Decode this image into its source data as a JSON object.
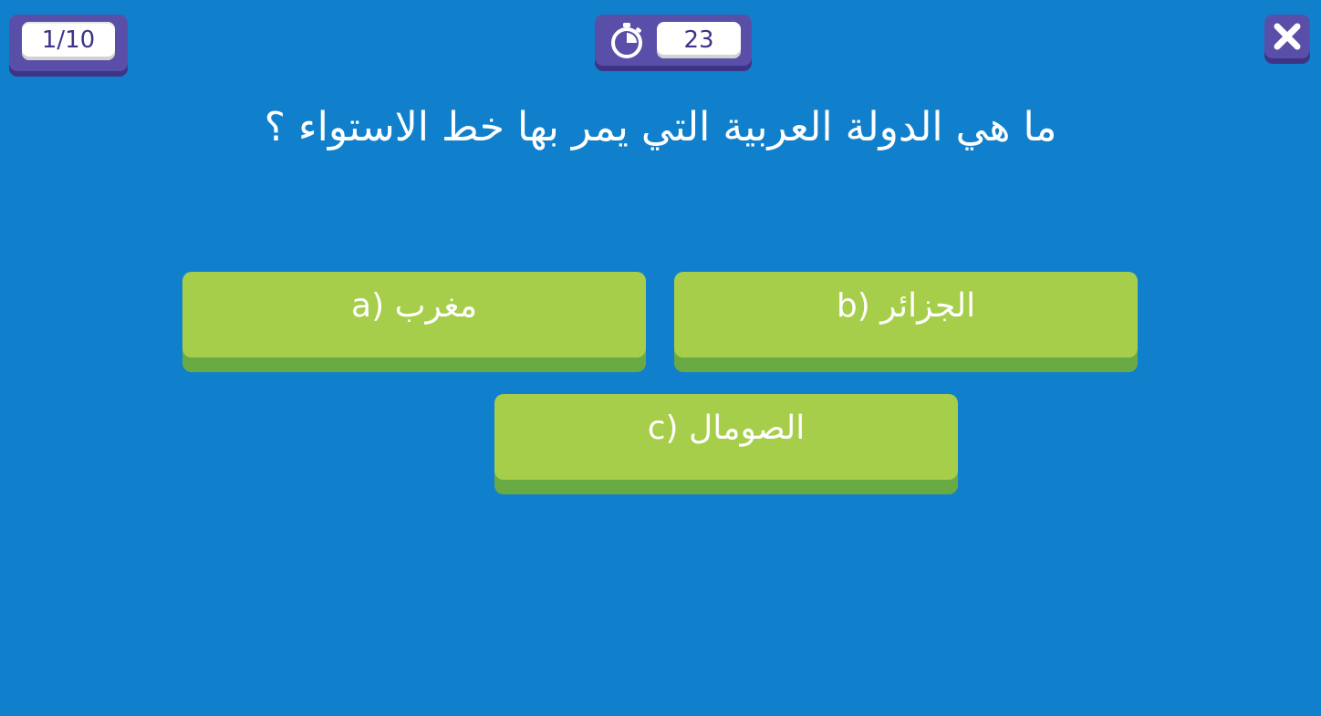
{
  "header": {
    "question_counter": "1/10",
    "timer_value": "23",
    "timer_icon": "stopwatch-icon",
    "close_icon": "close-icon"
  },
  "question": {
    "text": "ما هي الدولة العربية التي يمر بها خط الاستواء ؟"
  },
  "answers": [
    {
      "letter": "a",
      "label": "مغرب (a"
    },
    {
      "letter": "b",
      "label": "الجزائر (b"
    },
    {
      "letter": "c",
      "label": "الصومال (c"
    }
  ],
  "colors": {
    "background": "#1180cc",
    "panel": "#5a4fa8",
    "panel_shadow": "#3d3488",
    "answer": "#a6ce4a",
    "answer_shadow": "#6aaa45",
    "text": "#ffffff"
  }
}
